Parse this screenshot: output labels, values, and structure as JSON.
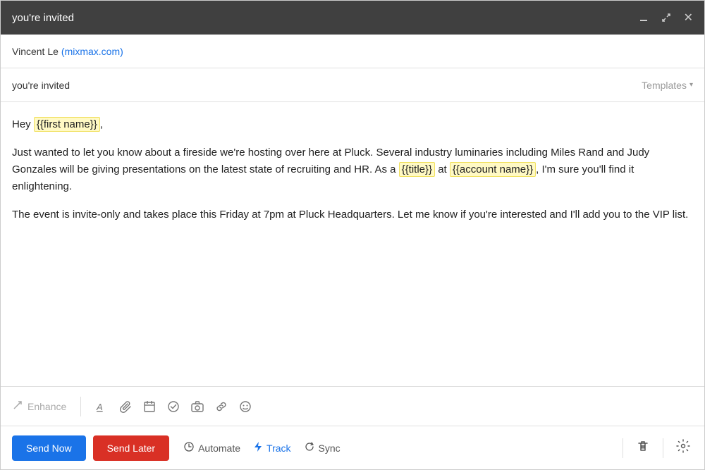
{
  "titleBar": {
    "title": "you're invited",
    "minimizeIcon": "—",
    "expandIcon": "⛶",
    "closeIcon": "✕"
  },
  "toField": {
    "senderName": "Vincent Le",
    "senderEmail": "(mixmax.com)"
  },
  "subjectField": {
    "subject": "you're invited",
    "templatesLabel": "Templates"
  },
  "emailBody": {
    "greeting": "Hey ",
    "firstNamePlaceholder": "{{first name}}",
    "greetingEnd": ",",
    "paragraph1": "Just wanted to let you know about a fireside we're hosting over here at Pluck. Several industry luminaries including Miles Rand and Judy Gonzales will be giving presentations on the latest state of recruiting and HR. As a ",
    "titlePlaceholder": "{{title}}",
    "atText": " at ",
    "accountNamePlaceholder": "{{account name}}",
    "paragraph1End": ", I'm sure you'll find it enlightening.",
    "paragraph2": "The event is invite-only and takes place this Friday at 7pm at Pluck Headquarters. Let me know if you're interested and I'll add you to the VIP list."
  },
  "toolbar": {
    "enhanceLabel": "Enhance",
    "icons": [
      "✎",
      "A",
      "⊕",
      "⊞",
      "✓",
      "⊡",
      "⊝",
      "☺"
    ]
  },
  "bottomBar": {
    "sendNowLabel": "Send Now",
    "sendLaterLabel": "Send Later",
    "automateLabel": "Automate",
    "trackLabel": "Track",
    "syncLabel": "Sync"
  }
}
